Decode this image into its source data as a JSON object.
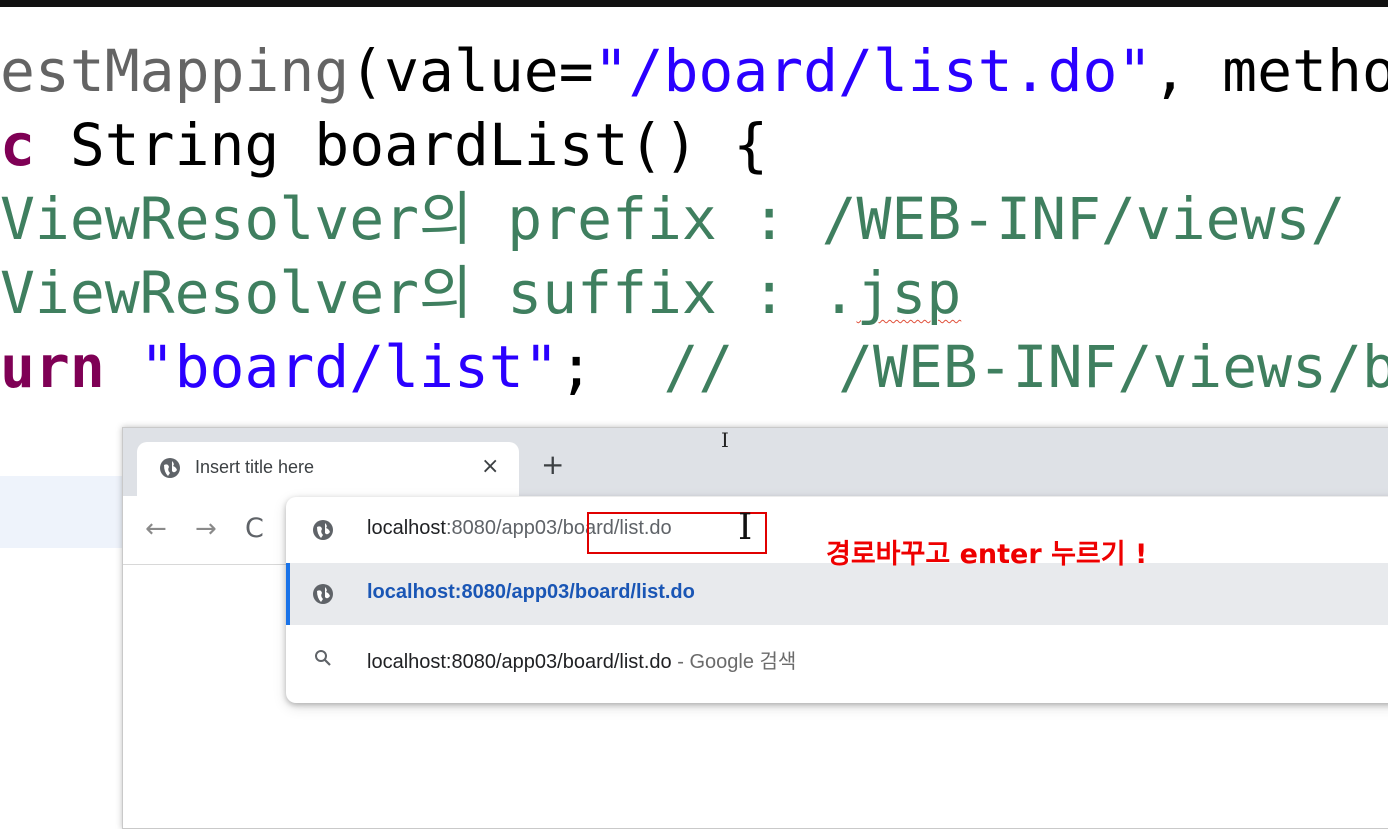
{
  "code": {
    "line1": {
      "a": "estMapping",
      "b": "(value=",
      "c": "\"/board/list.do\"",
      "d": ", method=Re"
    },
    "line2": {
      "a": "c",
      "b": " String boardList() {"
    },
    "line3": "ViewResolver의 prefix : /WEB-INF/views/",
    "line4": {
      "a": "ViewResolver의 suffix : .",
      "b": "jsp"
    },
    "line5": {
      "a": "urn",
      "b": " ",
      "c": "\"board/list\"",
      "d": ";  ",
      "e": "//   /WEB-INF/views/board"
    }
  },
  "browser": {
    "tab_title": "Insert title here",
    "tab_close": "×",
    "new_tab": "+",
    "nav": {
      "back": "←",
      "forward": "→",
      "reload": "C"
    },
    "omnibox": {
      "input_host": "localhost",
      "input_path_before": ":8080/app03/",
      "input_path_after": "board/list.do",
      "suggestion_url": "localhost:8080/app03/board/list.do",
      "search_url": "localhost:8080/app03/board/list.do",
      "search_suffix": " - Google 검색"
    }
  },
  "annotation": "경로바꾸고 enter 누르기 !",
  "icons": [
    "globe-icon",
    "search-icon",
    "back-arrow-icon",
    "forward-arrow-icon",
    "reload-icon",
    "close-icon",
    "plus-icon",
    "text-cursor-icon"
  ],
  "colors": {
    "annotation_red": "#ee0000",
    "comment_green": "#3f7f5f",
    "string_blue": "#2a00ff",
    "keyword_purple": "#7f0055"
  }
}
